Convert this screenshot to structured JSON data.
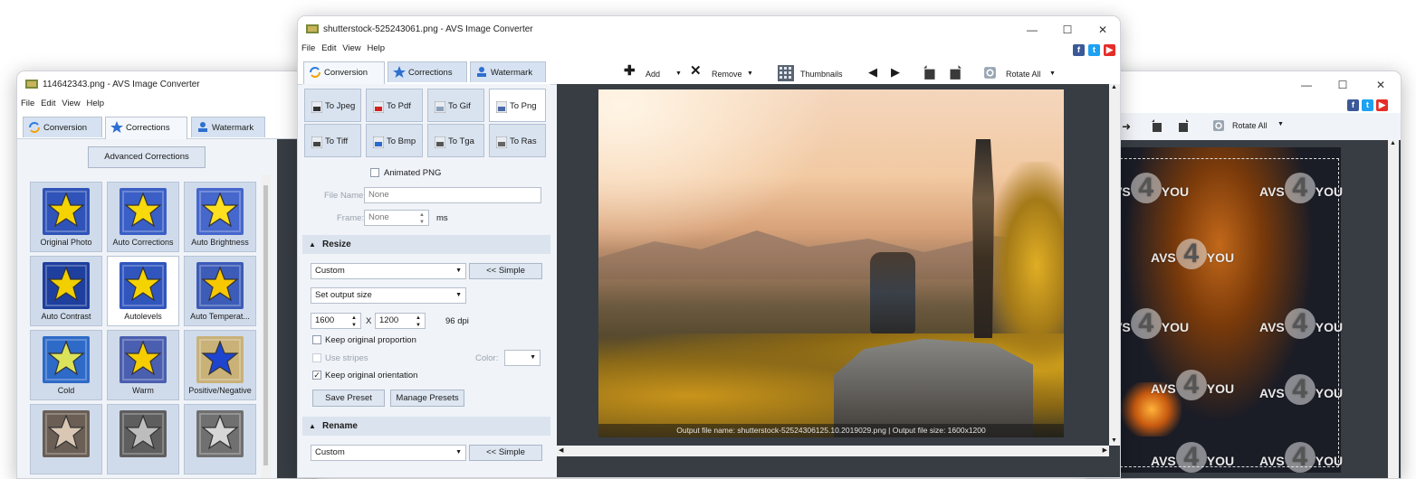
{
  "left_window": {
    "title": "114642343.png - AVS Image Converter",
    "menu": [
      "File",
      "Edit",
      "View",
      "Help"
    ],
    "tabs": [
      {
        "label": "Conversion",
        "icon": "refresh-icon"
      },
      {
        "label": "Corrections",
        "icon": "star-icon"
      },
      {
        "label": "Watermark",
        "icon": "user-stamp-icon"
      }
    ],
    "advanced_button": "Advanced Corrections",
    "effects": [
      {
        "label": "Original Photo",
        "color": "#2f53b8",
        "star": "#f5d300"
      },
      {
        "label": "Auto Corrections",
        "color": "#3a5fc6",
        "star": "#f7d90c"
      },
      {
        "label": "Auto Brightness",
        "color": "#4667cc",
        "star": "#ffe020"
      },
      {
        "label": "Auto Contrast",
        "color": "#1e3f9e",
        "star": "#f1cf00"
      },
      {
        "label": "Autolevels",
        "color": "#3056be",
        "star": "#f5d300"
      },
      {
        "label": "Auto Temperat...",
        "color": "#3d5cb8",
        "star": "#f7c700"
      },
      {
        "label": "Cold",
        "color": "#2e6ac8",
        "star": "#dbe35a"
      },
      {
        "label": "Warm",
        "color": "#4b5fb0",
        "star": "#f5cd00"
      },
      {
        "label": "Positive/Negative",
        "color": "#c9b178",
        "star": "#1e45d0"
      },
      {
        "label": "",
        "color": "#6a5e55",
        "star": "#d9c7b4"
      },
      {
        "label": "",
        "color": "#5e5e5e",
        "star": "#bdbdbd"
      },
      {
        "label": "",
        "color": "#707070",
        "star": "#d6d6d6"
      }
    ]
  },
  "right_window": {
    "rotate_all": "Rotate All",
    "watermark_text": [
      "AVS",
      "4",
      "YOU"
    ]
  },
  "main_window": {
    "title": "shutterstock-525243061.png - AVS Image Converter",
    "menu": [
      "File",
      "Edit",
      "View",
      "Help"
    ],
    "tabs": [
      {
        "label": "Conversion",
        "icon": "refresh-icon"
      },
      {
        "label": "Corrections",
        "icon": "star-icon"
      },
      {
        "label": "Watermark",
        "icon": "user-stamp-icon"
      }
    ],
    "toolbar": {
      "add": "Add",
      "remove": "Remove",
      "thumbnails": "Thumbnails",
      "rotate_all": "Rotate All"
    },
    "formats": [
      {
        "label": "To Jpeg",
        "icon_color": "#333333"
      },
      {
        "label": "To Pdf",
        "icon_color": "#d42020"
      },
      {
        "label": "To Gif",
        "icon_color": "#8aa0b8"
      },
      {
        "label": "To Png",
        "icon_color": "#4a6aa8"
      },
      {
        "label": "To Tiff",
        "icon_color": "#444444"
      },
      {
        "label": "To Bmp",
        "icon_color": "#2a6bd0"
      },
      {
        "label": "To Tga",
        "icon_color": "#555555"
      },
      {
        "label": "To Ras",
        "icon_color": "#666666"
      }
    ],
    "animated_png": "Animated PNG",
    "file_name_label": "File Name:",
    "file_name_value": "None",
    "frame_label": "Frame:",
    "frame_value": "None",
    "frame_unit": "ms",
    "resize": {
      "heading": "Resize",
      "preset": "Custom",
      "simple_button": "<< Simple",
      "size_mode": "Set output size",
      "width": "1600",
      "x_label": "X",
      "height": "1200",
      "dpi": "96 dpi",
      "keep_proportion": "Keep original proportion",
      "use_stripes": "Use stripes",
      "color_label": "Color:",
      "keep_orientation": "Keep original orientation",
      "save_preset": "Save Preset",
      "manage_presets": "Manage Presets"
    },
    "rename": {
      "heading": "Rename",
      "preset": "Custom",
      "simple_button": "<< Simple"
    },
    "preview_status": "Output file name: shutterstock-52524306125.10.2019029.png | Output file size: 1600x1200"
  }
}
